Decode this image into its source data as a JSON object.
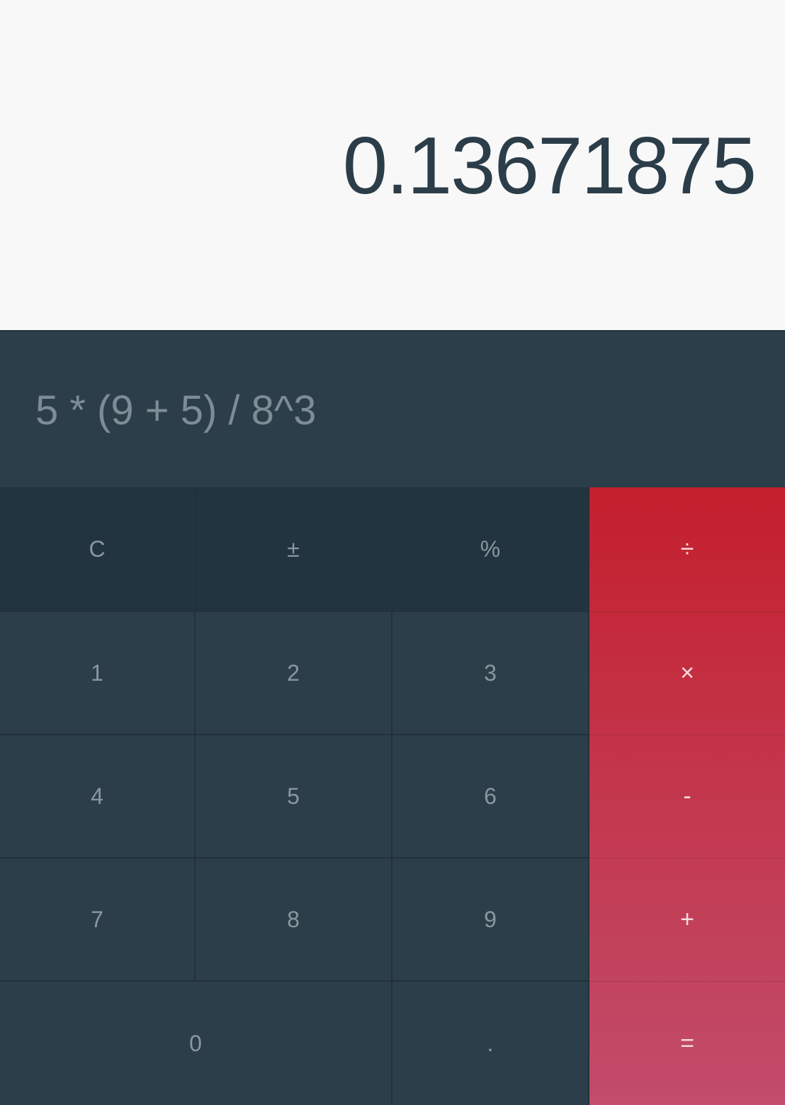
{
  "display": {
    "result": "0.13671875",
    "expression": "5 * (9 + 5) / 8^3"
  },
  "keys": {
    "clear": "C",
    "sign": "±",
    "percent": "%",
    "divide": "÷",
    "one": "1",
    "two": "2",
    "three": "3",
    "multiply": "×",
    "four": "4",
    "five": "5",
    "six": "6",
    "minus": "-",
    "seven": "7",
    "eight": "8",
    "nine": "9",
    "plus": "+",
    "zero": "0",
    "decimal": ".",
    "equals": "="
  },
  "colors": {
    "display_bg": "#f8f8f8",
    "keypad_bg": "#2c3e49",
    "function_row_bg": "#22343f",
    "operator_top": "#c41f2d",
    "operator_bottom": "#c24c6b"
  }
}
